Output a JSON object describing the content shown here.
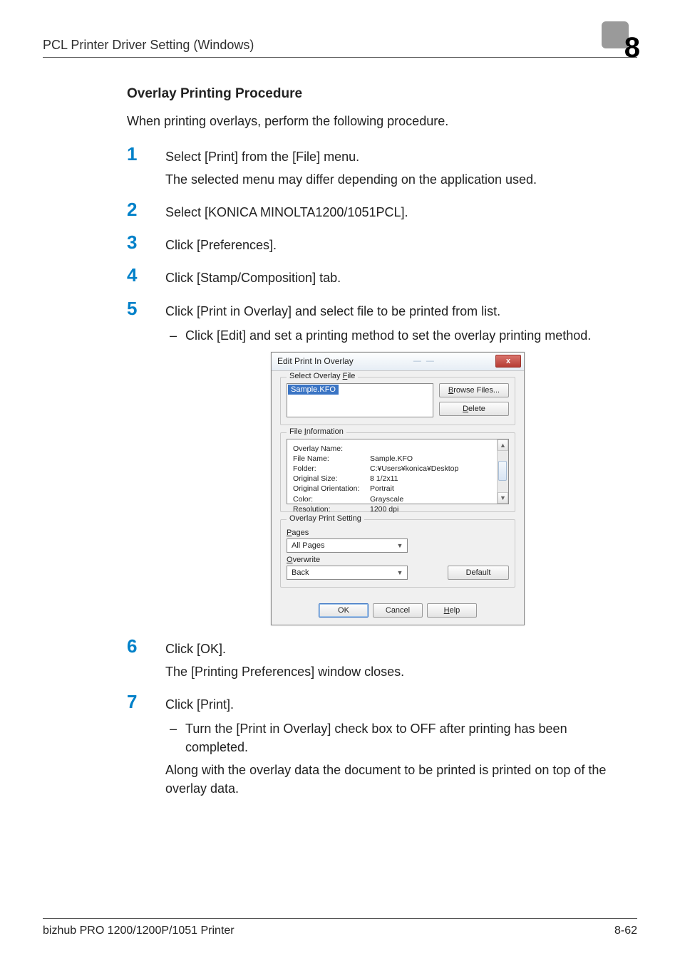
{
  "header": {
    "title": "PCL Printer Driver Setting (Windows)",
    "chapter": "8"
  },
  "section": {
    "heading": "Overlay Printing Procedure"
  },
  "intro": "When printing overlays, perform the following procedure.",
  "steps": {
    "s1": {
      "num": "1",
      "text": "Select [Print] from the [File] menu.",
      "sub": "The selected menu may differ depending on the application used."
    },
    "s2": {
      "num": "2",
      "text": "Select [KONICA MINOLTA1200/1051PCL]."
    },
    "s3": {
      "num": "3",
      "text": "Click [Preferences]."
    },
    "s4": {
      "num": "4",
      "text": "Click [Stamp/Composition] tab."
    },
    "s5": {
      "num": "5",
      "text": "Click [Print in Overlay] and select file to be printed from list.",
      "bullet": "Click [Edit] and set a printing method to set the overlay printing method."
    },
    "s6": {
      "num": "6",
      "text": "Click [OK].",
      "sub": "The [Printing Preferences] window closes."
    },
    "s7": {
      "num": "7",
      "text": "Click [Print].",
      "bullet": "Turn the [Print in Overlay] check box to OFF after printing has been completed.",
      "sub": "Along with the overlay data the document to be printed is printed on top of the overlay data."
    }
  },
  "dialog": {
    "title": "Edit Print In Overlay",
    "close": "x",
    "groups": {
      "select_file": {
        "label_select": "Select Overlay ",
        "label_f": "F",
        "label_ile": "ile",
        "selected": "Sample.KFO",
        "browse_b": "B",
        "browse_rest": "rowse Files...",
        "delete_d": "D",
        "delete_rest": "elete"
      },
      "file_info": {
        "label_file": "File ",
        "label_i": "I",
        "label_nfo": "nformation",
        "rows": [
          {
            "k": "Overlay Name:",
            "v": ""
          },
          {
            "k": "File Name:",
            "v": "Sample.KFO"
          },
          {
            "k": "Folder:",
            "v": "C:¥Users¥konica¥Desktop"
          },
          {
            "k": "",
            "v": ""
          },
          {
            "k": "Original Size:",
            "v": "8 1/2x11"
          },
          {
            "k": "Original Orientation:",
            "v": "Portrait"
          },
          {
            "k": "Color:",
            "v": "Grayscale"
          },
          {
            "k": "Resolution:",
            "v": "1200 dpi"
          }
        ]
      },
      "print_setting": {
        "label": "Overlay Print Setting",
        "pages_p": "P",
        "pages_rest": "ages",
        "pages_value": "All Pages",
        "overwrite_o": "O",
        "overwrite_rest": "verwrite",
        "overwrite_value": "Back",
        "default": "Default"
      }
    },
    "buttons": {
      "ok": "OK",
      "cancel": "Cancel",
      "help_h": "H",
      "help_rest": "elp"
    }
  },
  "footer": {
    "left": "bizhub PRO 1200/1200P/1051 Printer",
    "right": "8-62"
  }
}
